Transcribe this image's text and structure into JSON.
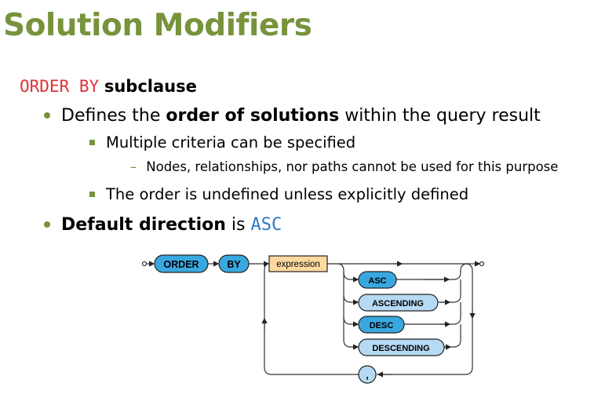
{
  "title": "Solution Modifiers",
  "heading": {
    "keyword": "ORDER BY",
    "rest": "subclause"
  },
  "bullets": {
    "b1": {
      "pre": "Defines the ",
      "bold": "order of solutions",
      "post": " within the query result"
    },
    "b1_1": "Multiple criteria can be specified",
    "b1_1_1": "Nodes, relationships, nor paths cannot be used for this purpose",
    "b1_2": "The order is undefined unless explicitly defined",
    "b2": {
      "bold": "Default direction",
      "mid": " is ",
      "code": "ASC"
    }
  },
  "diagram": {
    "order": "ORDER",
    "by": "BY",
    "expression": "expression",
    "asc": "ASC",
    "ascending": "ASCENDING",
    "desc": "DESC",
    "descending": "DESCENDING",
    "comma": ",",
    "colors": {
      "keyword_dark": "#3AA8E0",
      "keyword_light": "#B6DAF3",
      "nonterminal": "#FDD9A0"
    }
  }
}
